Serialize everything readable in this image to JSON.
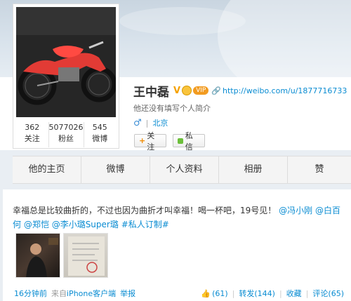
{
  "profile": {
    "name": "王中磊",
    "verified_badge": "V",
    "vip_label": "VIP",
    "url": "http://weibo.com/u/1877716733",
    "bio": "他还没有填写个人简介",
    "location": "北京",
    "follow_label": "关注",
    "message_label": "私信"
  },
  "stats": [
    {
      "num": "362",
      "label": "关注"
    },
    {
      "num": "5077026",
      "label": "粉丝"
    },
    {
      "num": "545",
      "label": "微博"
    }
  ],
  "nav": {
    "tabs": [
      "他的主页",
      "微博",
      "个人资料",
      "相册",
      "赞"
    ]
  },
  "post": {
    "text_main": "幸福总是比较曲折的，不过也因为曲折才叫幸福！喝一杯吧，19号见！",
    "mention1": "@冯小刚",
    "mention2": "@白百何",
    "mention3": "@郑恺",
    "mention4": "@李小璐Super璐",
    "hashtag": "#私人订制#",
    "time": "16分钟前",
    "from_label": "来自",
    "client": "iPhone客户端",
    "report": "举报",
    "likes": "(61)",
    "repost": "转发(144)",
    "favorite": "收藏",
    "comment": "评论(65)"
  },
  "colors": {
    "link": "#0a8cd2",
    "vip": "#f29b20",
    "verified": "#f5a100"
  },
  "icons": {
    "male": "male-icon",
    "like": "thumb-up-icon",
    "url": "link-icon"
  }
}
